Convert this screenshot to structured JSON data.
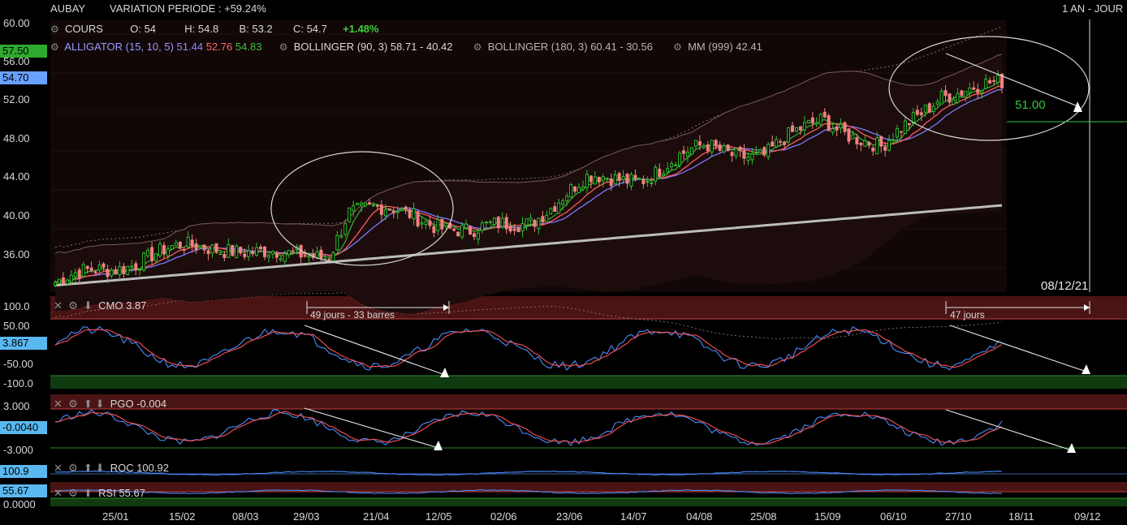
{
  "header": {
    "symbol": "AUBAY",
    "variation": "VARIATION PERIODE : +59.24%",
    "period": "1 AN - JOUR"
  },
  "quote": {
    "label": "COURS",
    "open_label": "O:",
    "open": "54",
    "high_label": "H:",
    "high": "54.8",
    "low_label": "B:",
    "low": "53.2",
    "close_label": "C:",
    "close": "54.7",
    "change": "+1.48%"
  },
  "indicators": {
    "alligator_label": "ALLIGATOR (15, 10, 5)",
    "alligator_v1": "51.44",
    "alligator_v2": "52.76",
    "alligator_v3": "54.83",
    "boll1": "BOLLINGER (90, 3) 58.71 - 40.42",
    "boll2": "BOLLINGER (180, 3) 60.41 - 30.56",
    "mm": "MM (999) 42.41"
  },
  "price_axis": {
    "ticks": [
      "60.00",
      "56.00",
      "52.00",
      "48.00",
      "44.00",
      "40.00",
      "36.00"
    ],
    "flag_high": "57.50",
    "flag_last": "54.70",
    "target_label": "51.00",
    "date_marker": "08/12/21"
  },
  "x_axis": {
    "ticks": [
      "25/01",
      "15/02",
      "08/03",
      "29/03",
      "21/04",
      "12/05",
      "02/06",
      "23/06",
      "14/07",
      "04/08",
      "25/08",
      "15/09",
      "06/10",
      "27/10",
      "18/11",
      "09/12"
    ]
  },
  "annotations": {
    "span1": "49 jours - 33 barres",
    "span2": "47 jours"
  },
  "cmo": {
    "title": "CMO 3.87",
    "flag": "3.867",
    "ticks": [
      "100.0",
      "50.00",
      "-50.00",
      "-100.0"
    ]
  },
  "pgo": {
    "title": "PGO -0.004",
    "flag": "-0.0040",
    "ticks": [
      "3.000",
      "-3.000"
    ]
  },
  "roc": {
    "title": "ROC 100.92",
    "flag": "100.9"
  },
  "rsi": {
    "title": "RSI 55.67",
    "flag": "55.67",
    "tick": "0.0000"
  },
  "colors": {
    "up": "#2fbf2f",
    "down": "#f08080",
    "blue_flag": "#6aa0ff",
    "green_flag": "#2eaa2e",
    "cyan_flag": "#5ab8f0",
    "jaw": "#7b7bff",
    "teeth": "#ff5b5b",
    "lips": "#31b531"
  },
  "chart_data": {
    "type": "candlestick",
    "title": "AUBAY",
    "period": "1 AN - JOUR",
    "ylim": [
      33,
      61
    ],
    "approx_close_path": [
      [
        "2020-12-14",
        34.5
      ],
      [
        "2021-01-04",
        36.0
      ],
      [
        "2021-01-18",
        37.5
      ],
      [
        "2021-01-25",
        37.8
      ],
      [
        "2021-02-15",
        38.2
      ],
      [
        "2021-03-08",
        37.0
      ],
      [
        "2021-03-22",
        37.5
      ],
      [
        "2021-03-29",
        42.0
      ],
      [
        "2021-04-21",
        41.5
      ],
      [
        "2021-05-12",
        39.5
      ],
      [
        "2021-06-02",
        41.0
      ],
      [
        "2021-06-23",
        45.0
      ],
      [
        "2021-07-14",
        45.5
      ],
      [
        "2021-08-04",
        48.5
      ],
      [
        "2021-08-25",
        47.5
      ],
      [
        "2021-09-15",
        51.5
      ],
      [
        "2021-10-06",
        48.0
      ],
      [
        "2021-10-27",
        54.0
      ],
      [
        "2021-11-18",
        54.7
      ]
    ],
    "series": [
      {
        "name": "ALLIGATOR (15, 10, 5)",
        "last_values": [
          51.44,
          52.76,
          54.83
        ]
      },
      {
        "name": "BOLLINGER (90, 3)",
        "upper": 58.71,
        "lower": 40.42
      },
      {
        "name": "BOLLINGER (180, 3)",
        "upper": 60.41,
        "lower": 30.56
      },
      {
        "name": "MM (999)",
        "last": 42.41
      }
    ],
    "projection_target": 51.0
  }
}
